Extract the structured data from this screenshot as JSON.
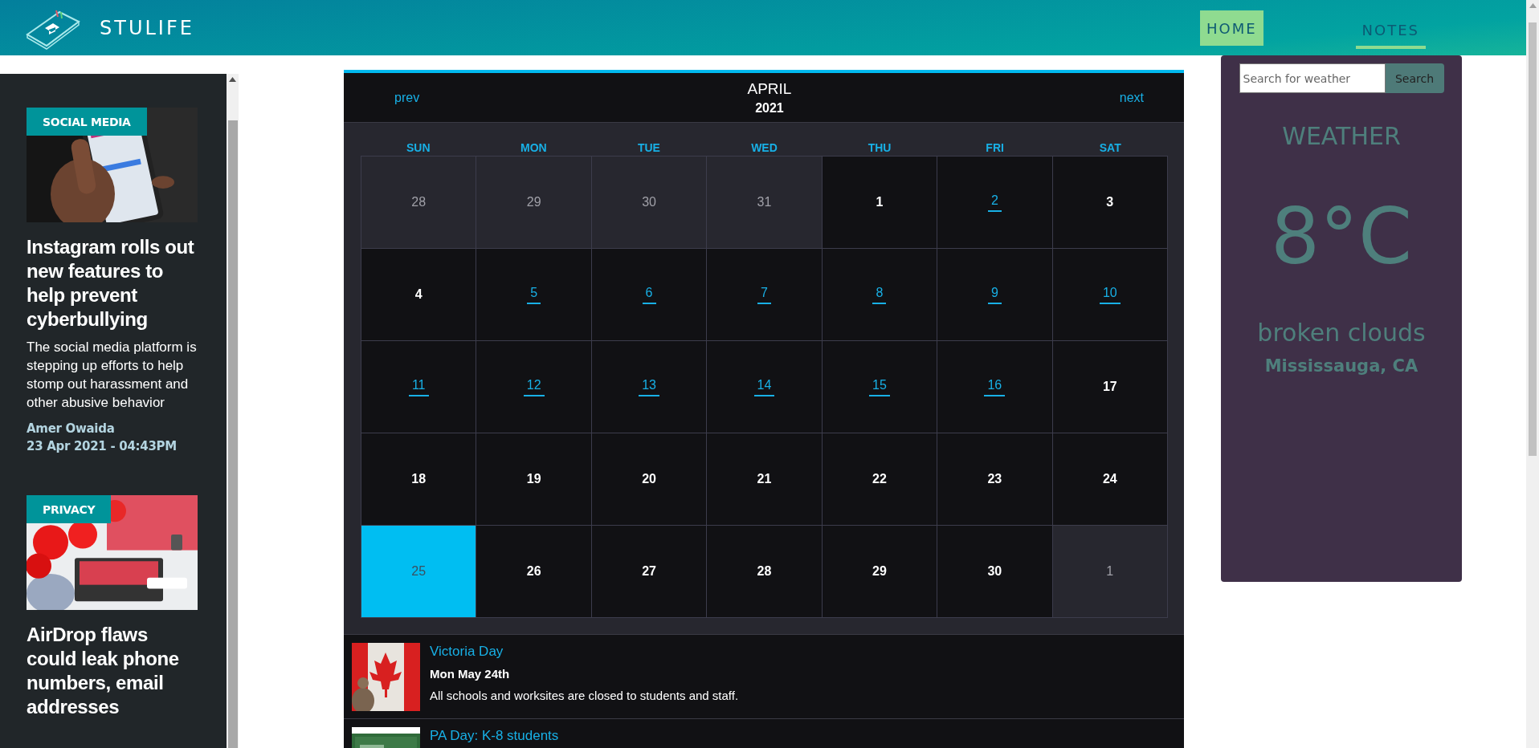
{
  "header": {
    "brand": "STULIFE",
    "nav": [
      {
        "label": "HOME",
        "selected": true,
        "underlined": false
      },
      {
        "label": "NOTES",
        "selected": false,
        "underlined": true
      }
    ]
  },
  "sidebar": {
    "articles": [
      {
        "tag": "SOCIAL MEDIA",
        "title": "Instagram rolls out new features to help prevent cyberbullying",
        "summary": "The social media platform is stepping up efforts to help stomp out harassment and other abusive behavior",
        "author": "Amer Owaida",
        "date": "23 Apr 2021 - 04:43PM"
      },
      {
        "tag": "PRIVACY",
        "title": "AirDrop flaws could leak phone numbers, email addresses"
      }
    ]
  },
  "calendar": {
    "prev": "prev",
    "next": "next",
    "month": "APRIL",
    "year": "2021",
    "weekdays": [
      "SUN",
      "MON",
      "TUE",
      "WED",
      "THU",
      "FRI",
      "SAT"
    ],
    "days": [
      {
        "label": "28",
        "kind": "outside",
        "selected": false
      },
      {
        "label": "29",
        "kind": "outside",
        "selected": false
      },
      {
        "label": "30",
        "kind": "outside",
        "selected": false
      },
      {
        "label": "31",
        "kind": "outside",
        "selected": false
      },
      {
        "label": "1",
        "kind": "plain",
        "selected": false
      },
      {
        "label": "2",
        "kind": "event",
        "selected": false
      },
      {
        "label": "3",
        "kind": "plain",
        "selected": false
      },
      {
        "label": "4",
        "kind": "plain",
        "selected": false
      },
      {
        "label": "5",
        "kind": "event",
        "selected": false
      },
      {
        "label": "6",
        "kind": "event",
        "selected": false
      },
      {
        "label": "7",
        "kind": "event",
        "selected": false
      },
      {
        "label": "8",
        "kind": "event",
        "selected": false
      },
      {
        "label": "9",
        "kind": "event",
        "selected": false
      },
      {
        "label": "10",
        "kind": "event",
        "selected": false
      },
      {
        "label": "11",
        "kind": "event",
        "selected": false
      },
      {
        "label": "12",
        "kind": "event",
        "selected": false
      },
      {
        "label": "13",
        "kind": "event",
        "selected": false
      },
      {
        "label": "14",
        "kind": "event",
        "selected": false
      },
      {
        "label": "15",
        "kind": "event",
        "selected": false
      },
      {
        "label": "16",
        "kind": "event",
        "selected": false
      },
      {
        "label": "17",
        "kind": "plain",
        "selected": false
      },
      {
        "label": "18",
        "kind": "plain",
        "selected": false
      },
      {
        "label": "19",
        "kind": "plain",
        "selected": false
      },
      {
        "label": "20",
        "kind": "plain",
        "selected": false
      },
      {
        "label": "21",
        "kind": "plain",
        "selected": false
      },
      {
        "label": "22",
        "kind": "plain",
        "selected": false
      },
      {
        "label": "23",
        "kind": "plain",
        "selected": false
      },
      {
        "label": "24",
        "kind": "plain",
        "selected": false
      },
      {
        "label": "25",
        "kind": "plain",
        "selected": true
      },
      {
        "label": "26",
        "kind": "plain",
        "selected": false
      },
      {
        "label": "27",
        "kind": "plain",
        "selected": false
      },
      {
        "label": "28",
        "kind": "plain",
        "selected": false
      },
      {
        "label": "29",
        "kind": "plain",
        "selected": false
      },
      {
        "label": "30",
        "kind": "plain",
        "selected": false
      },
      {
        "label": "1",
        "kind": "outside",
        "selected": false
      }
    ],
    "events": [
      {
        "title": "Victoria Day",
        "date": "Mon May 24th",
        "description": "All schools and worksites are closed to students and staff."
      },
      {
        "title": "PA Day: K-8 students"
      }
    ]
  },
  "weather": {
    "search": {
      "placeholder": "Search for weather",
      "button": "Search"
    },
    "heading": "WEATHER",
    "temperature": "8°C",
    "condition": "broken clouds",
    "location": "Mississauga, CA"
  }
}
